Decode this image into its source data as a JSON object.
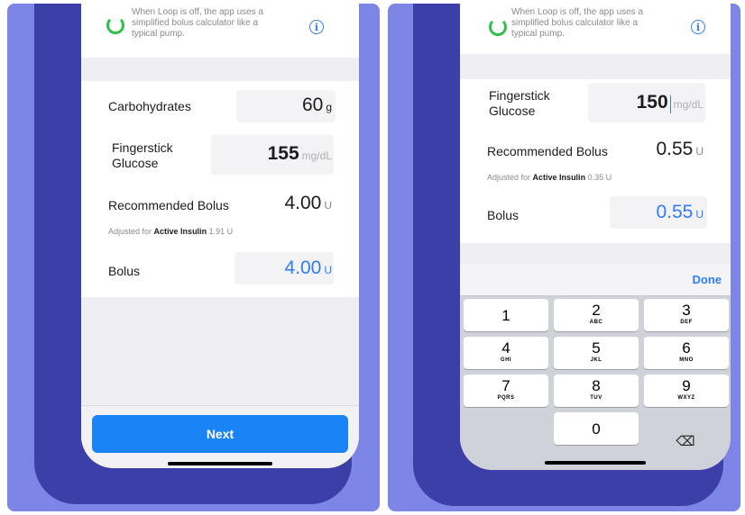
{
  "left": {
    "info_text": [
      "When Loop is off, the app uses a",
      "simplified bolus calculator like a",
      "typical pump."
    ],
    "carbs": {
      "label": "Carbohydrates",
      "value": "60",
      "unit": "g"
    },
    "glucose": {
      "label_line1": "Fingerstick",
      "label_line2": "Glucose",
      "value": "155",
      "unit": "mg/dL"
    },
    "recommended": {
      "label": "Recommended Bolus",
      "value": "4.00",
      "unit": "U"
    },
    "adjusted": {
      "prefix": "Adjusted for",
      "bold": "Active Insulin",
      "value": "1.91 U"
    },
    "bolus": {
      "label": "Bolus",
      "value": "4.00",
      "unit": "U"
    },
    "next_label": "Next"
  },
  "right": {
    "info_text": [
      "When Loop is off, the app uses a",
      "simplified bolus calculator like a",
      "typical pump."
    ],
    "glucose": {
      "label_line1": "Fingerstick",
      "label_line2": "Glucose",
      "value": "150",
      "unit": "mg/dL"
    },
    "recommended": {
      "label": "Recommended Bolus",
      "value": "0.55",
      "unit": "U"
    },
    "adjusted": {
      "prefix": "Adjusted for",
      "bold": "Active Insulin",
      "value": "0.35 U"
    },
    "bolus": {
      "label": "Bolus",
      "value": "0.55",
      "unit": "U"
    },
    "keyboard": {
      "done_label": "Done",
      "keys": [
        {
          "digit": "1",
          "letters": ""
        },
        {
          "digit": "2",
          "letters": "ABC"
        },
        {
          "digit": "3",
          "letters": "DEF"
        },
        {
          "digit": "4",
          "letters": "GHI"
        },
        {
          "digit": "5",
          "letters": "JKL"
        },
        {
          "digit": "6",
          "letters": "MNO"
        },
        {
          "digit": "7",
          "letters": "PQRS"
        },
        {
          "digit": "8",
          "letters": "TUV"
        },
        {
          "digit": "9",
          "letters": "WXYZ"
        },
        {
          "digit": "0",
          "letters": ""
        }
      ],
      "delete_icon": "delete-backspace-icon"
    }
  },
  "colors": {
    "background": "#7d86e6",
    "phone": "#3d3fa8",
    "accent": "#2f7df6",
    "loop_green": "#2fbf4a",
    "button": "#1a83f5"
  }
}
